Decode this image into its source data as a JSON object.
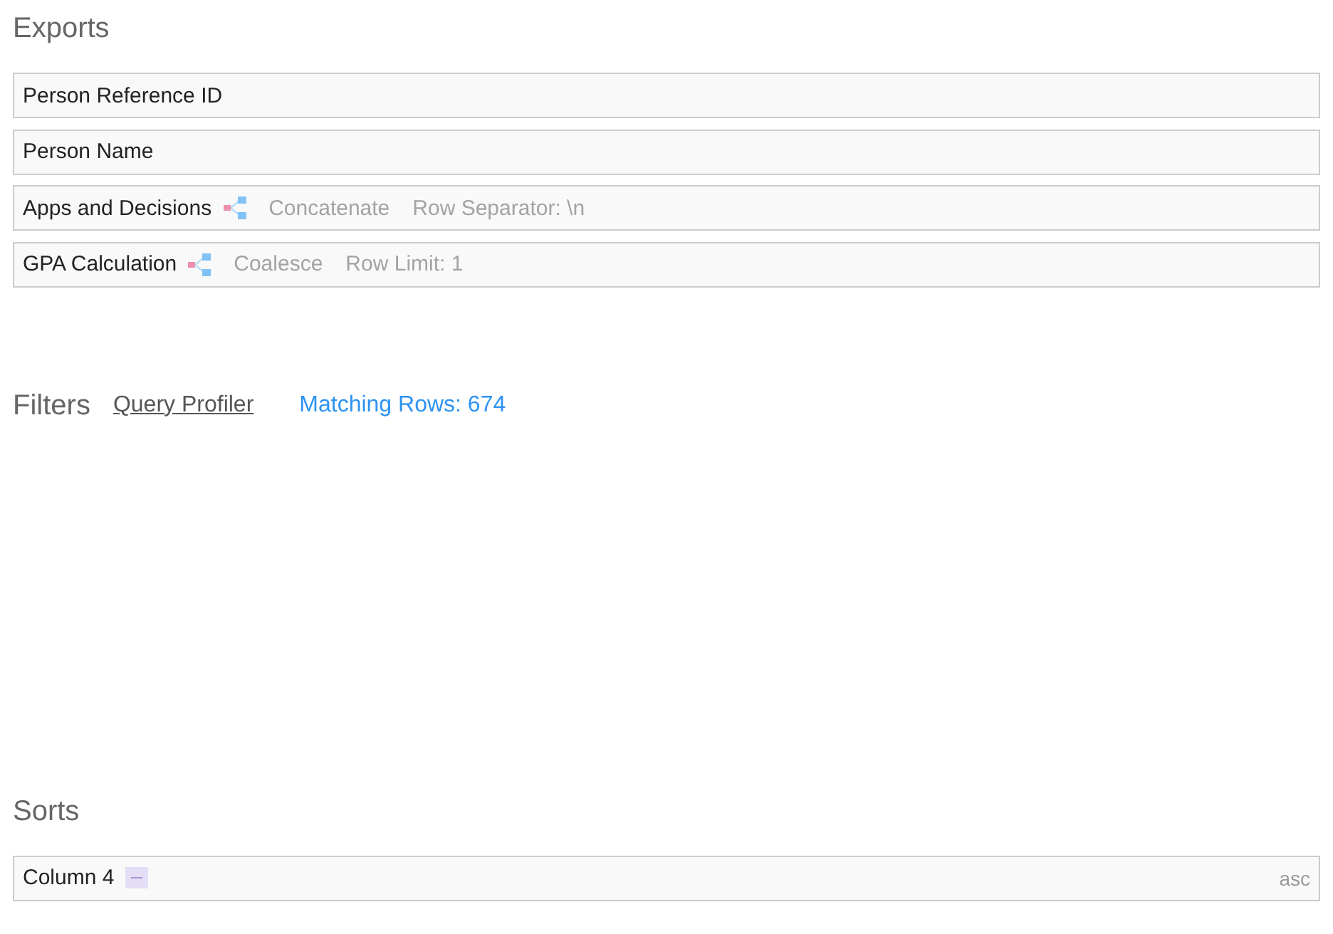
{
  "exports": {
    "title": "Exports",
    "rows": [
      {
        "kind": "plain",
        "label": "Person Reference ID"
      },
      {
        "kind": "plain",
        "label": "Person Name"
      },
      {
        "kind": "aggregate",
        "label": "Apps and Decisions",
        "function": "Concatenate",
        "option": "Row Separator: \\n"
      },
      {
        "kind": "aggregate",
        "label": "GPA Calculation",
        "function": "Coalesce",
        "option": "Row Limit: 1"
      }
    ]
  },
  "filters": {
    "title": "Filters",
    "profiler_link": "Query Profiler",
    "matching_rows": "Matching Rows: 674"
  },
  "sorts": {
    "title": "Sorts",
    "rows": [
      {
        "kind": "sql",
        "label": "Column 4",
        "direction": "asc"
      }
    ]
  }
}
